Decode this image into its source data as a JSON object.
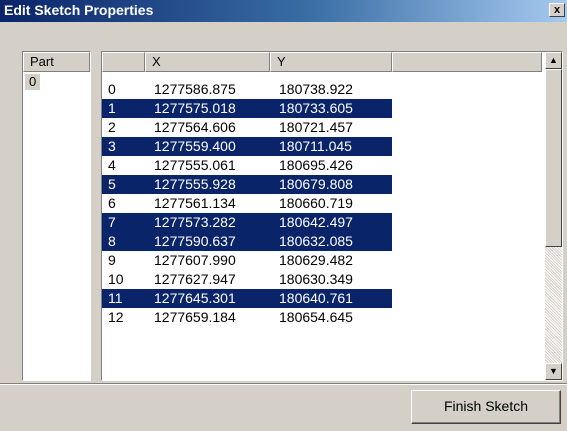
{
  "window": {
    "title": "Edit Sketch Properties",
    "close_label": "x"
  },
  "part_list": {
    "header": "Part",
    "items": [
      "0"
    ]
  },
  "grid": {
    "columns": [
      "",
      "X",
      "Y"
    ],
    "rows": [
      {
        "index": "0",
        "x": "1277586.875",
        "y": "180738.922",
        "selected": false
      },
      {
        "index": "1",
        "x": "1277575.018",
        "y": "180733.605",
        "selected": true
      },
      {
        "index": "2",
        "x": "1277564.606",
        "y": "180721.457",
        "selected": false
      },
      {
        "index": "3",
        "x": "1277559.400",
        "y": "180711.045",
        "selected": true
      },
      {
        "index": "4",
        "x": "1277555.061",
        "y": "180695.426",
        "selected": false
      },
      {
        "index": "5",
        "x": "1277555.928",
        "y": "180679.808",
        "selected": true
      },
      {
        "index": "6",
        "x": "1277561.134",
        "y": "180660.719",
        "selected": false
      },
      {
        "index": "7",
        "x": "1277573.282",
        "y": "180642.497",
        "selected": true
      },
      {
        "index": "8",
        "x": "1277590.637",
        "y": "180632.085",
        "selected": true
      },
      {
        "index": "9",
        "x": "1277607.990",
        "y": "180629.482",
        "selected": false
      },
      {
        "index": "10",
        "x": "1277627.947",
        "y": "180630.349",
        "selected": false
      },
      {
        "index": "11",
        "x": "1277645.301",
        "y": "180640.761",
        "selected": true
      },
      {
        "index": "12",
        "x": "1277659.184",
        "y": "180654.645",
        "selected": false
      }
    ],
    "selection_color": "#0a246a"
  },
  "scrollbar": {
    "up_icon": "scroll-up-arrow-icon",
    "down_icon": "scroll-down-arrow-icon",
    "up_glyph": "▲",
    "down_glyph": "▼"
  },
  "footer": {
    "finish_label": "Finish Sketch"
  }
}
